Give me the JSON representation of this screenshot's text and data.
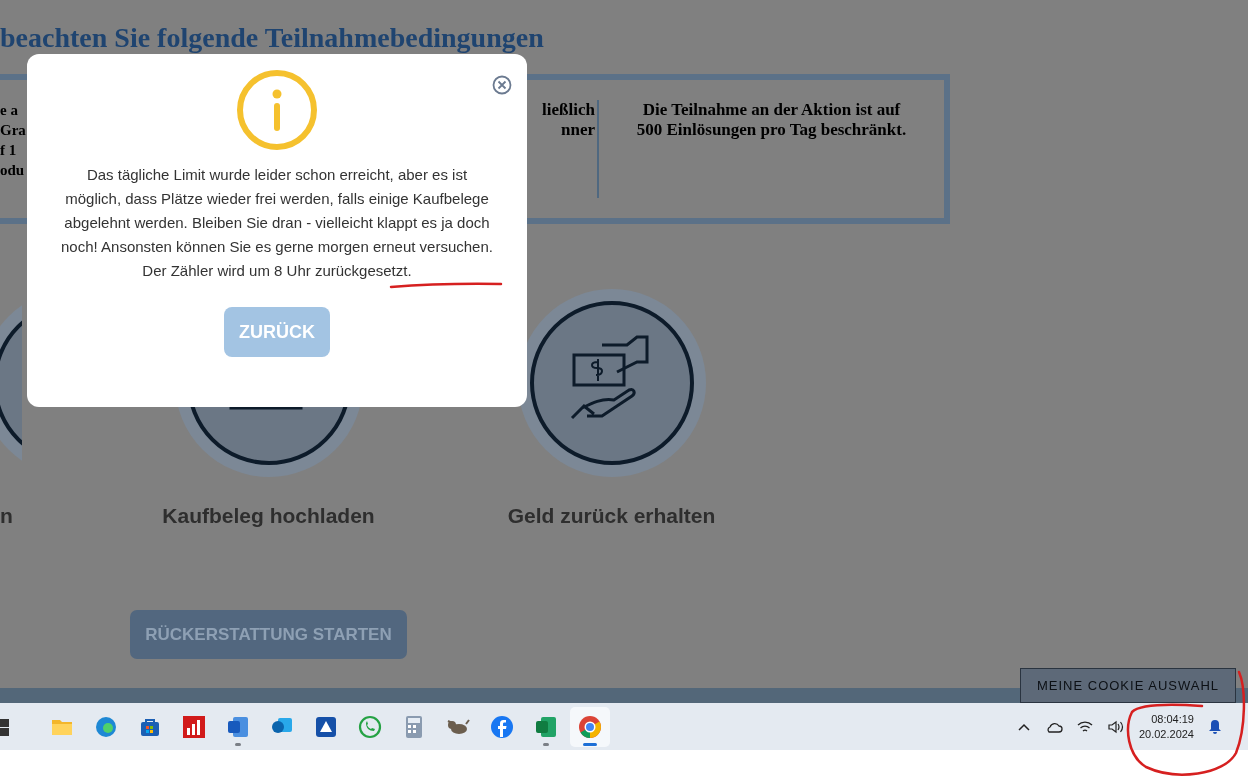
{
  "page": {
    "heading": "beachten Sie folgende Teilnahmebedingungen",
    "conditions": [
      {
        "kind": "left",
        "lines": [
          "e a",
          "Gra",
          "f 1",
          "odu"
        ]
      },
      {
        "kind": "middle",
        "lines": [
          "ließlich",
          "nner"
        ]
      },
      {
        "kind": "right",
        "lines": [
          "Die Teilnahme an der Aktion ist auf",
          "500 Einlösungen pro Tag beschränkt."
        ]
      }
    ],
    "steps": [
      {
        "kind": "partial",
        "label": "n"
      },
      {
        "kind": "receipt",
        "label": "Kaufbeleg hochladen"
      },
      {
        "kind": "money",
        "label": "Geld zurück erhalten"
      }
    ],
    "start_button": "RÜCKERSTATTUNG STARTEN",
    "cookie_button": "MEINE COOKIE AUSWAHL"
  },
  "dialog": {
    "message": "Das tägliche Limit wurde leider schon erreicht, aber es ist möglich, dass Plätze wieder frei werden, falls einige Kaufbelege abgelehnt werden. Bleiben Sie dran - vielleicht klappt es ja doch noch! Ansonsten können Sie es gerne morgen erneut versuchen. Der Zähler wird um 8 Uhr zurückgesetzt.",
    "button": "ZURÜCK"
  },
  "taskbar": {
    "apps": [
      {
        "kind": "start",
        "active": false
      },
      {
        "kind": "folder",
        "active": false
      },
      {
        "kind": "browser",
        "active": false
      },
      {
        "kind": "store",
        "active": false
      },
      {
        "kind": "chart",
        "active": false
      },
      {
        "kind": "word",
        "active": false,
        "running": true
      },
      {
        "kind": "mail",
        "active": false
      },
      {
        "kind": "scanner",
        "active": false
      },
      {
        "kind": "chat",
        "active": false
      },
      {
        "kind": "calculator",
        "active": false
      },
      {
        "kind": "animal",
        "active": false
      },
      {
        "kind": "social",
        "active": false
      },
      {
        "kind": "sheet",
        "active": false,
        "running": true
      },
      {
        "kind": "chrome",
        "active": true
      }
    ],
    "time": "08:04:19",
    "date": "20.02.2024"
  }
}
